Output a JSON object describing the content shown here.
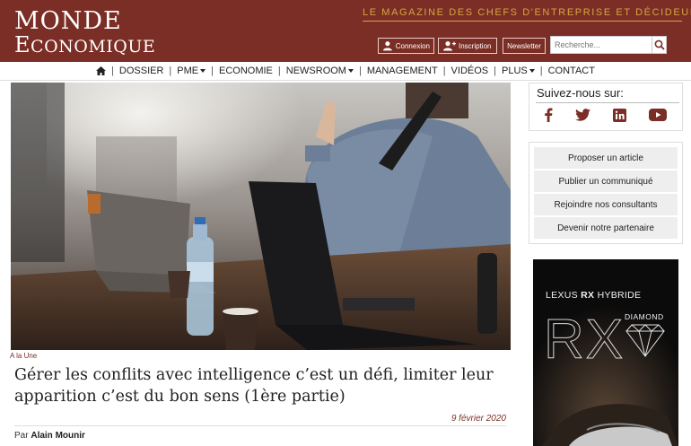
{
  "header": {
    "logo_line1": "MONDE",
    "logo_line2_first": "E",
    "logo_line2_rest": "CONOMIQUE",
    "tagline": "LE MAGAZINE DES CHEFS D'ENTREPRISE ET DÉCIDEURS",
    "login_label": "Connexion",
    "signup_label": "Inscription",
    "newsletter_label": "Newsletter",
    "search_placeholder": "Recherche..."
  },
  "nav": {
    "items": [
      "DOSSIER",
      "PME",
      "ECONOMIE",
      "NEWSROOM",
      "MANAGEMENT",
      "VIDÉOS",
      "PLUS",
      "CONTACT"
    ]
  },
  "article": {
    "category": "A la Une",
    "title": "Gérer les conflits avec intelligence c’est un défi, limiter leur apparition c’est du bon sens (1ère partie)",
    "date": "9 février 2020",
    "author_prefix": "Par",
    "author_name": "Alain Mounir"
  },
  "sidebar": {
    "follow_title": "Suivez-nous sur:",
    "social_icons": [
      "facebook-icon",
      "twitter-icon",
      "linkedin-icon",
      "youtube-icon"
    ],
    "links": [
      "Proposer un article",
      "Publier un communiqué",
      "Rejoindre nos consultants",
      "Devenir notre partenaire"
    ],
    "ad": {
      "brand": "LEXUS",
      "model": "RX",
      "suffix": "HYBRIDE",
      "big_mark": "RX",
      "edition": "DIAMOND"
    }
  },
  "colors": {
    "brand": "#7a2e25",
    "tagline": "#d9a441"
  }
}
